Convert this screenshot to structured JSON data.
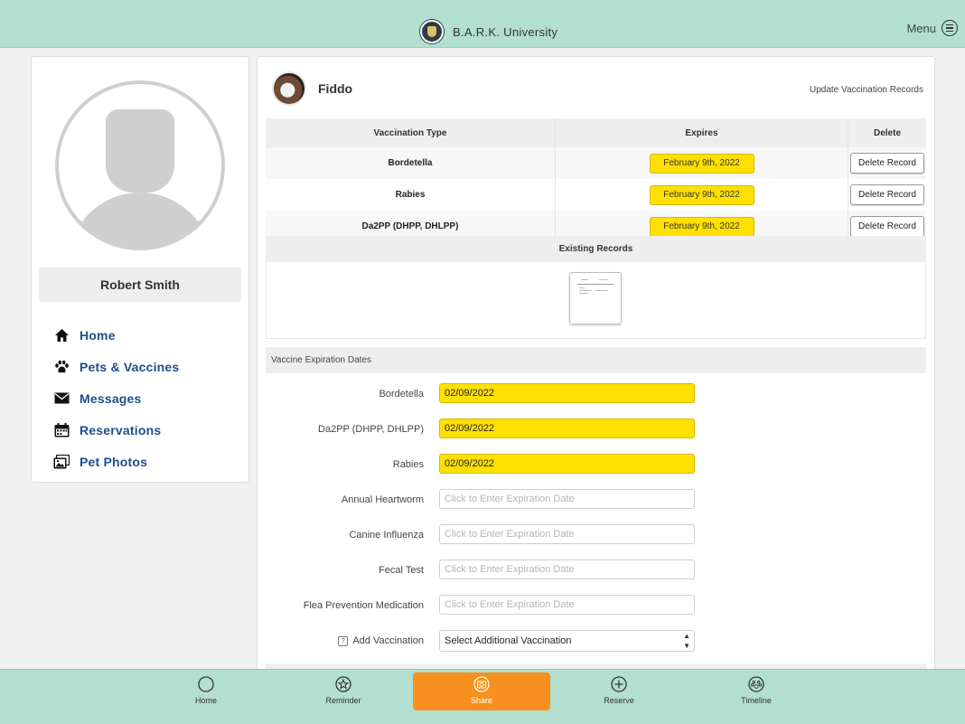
{
  "header": {
    "brand_name": "B.A.R.K. University",
    "menu_label": "Menu"
  },
  "profile": {
    "user_name": "Robert Smith"
  },
  "sidebar": {
    "items": [
      {
        "label": "Home",
        "icon": "house-icon"
      },
      {
        "label": "Pets & Vaccines",
        "icon": "paw-icon"
      },
      {
        "label": "Messages",
        "icon": "envelope-icon"
      },
      {
        "label": "Reservations",
        "icon": "calendar-icon"
      },
      {
        "label": "Pet Photos",
        "icon": "photos-icon"
      }
    ]
  },
  "pet": {
    "name": "Fiddo",
    "update_link": "Update Vaccination Records"
  },
  "vaccination_table": {
    "headers": {
      "type": "Vaccination Type",
      "expires": "Expires",
      "delete": "Delete"
    },
    "rows": [
      {
        "type": "Bordetella",
        "expires": "February 9th, 2022",
        "delete_label": "Delete Record"
      },
      {
        "type": "Rabies",
        "expires": "February 9th, 2022",
        "delete_label": "Delete Record"
      },
      {
        "type": "Da2PP (DHPP, DHLPP)",
        "expires": "February 9th, 2022",
        "delete_label": "Delete Record"
      }
    ]
  },
  "existing_records": {
    "title": "Existing Records"
  },
  "expiration_form": {
    "section_title": "Vaccine Expiration Dates",
    "placeholder": "Click to Enter Expiration Date",
    "fields": [
      {
        "label": "Bordetella",
        "value": "02/09/2022"
      },
      {
        "label": "Da2PP (DHPP, DHLPP)",
        "value": "02/09/2022"
      },
      {
        "label": "Rabies",
        "value": "02/09/2022"
      },
      {
        "label": "Annual Heartworm",
        "value": ""
      },
      {
        "label": "Canine Influenza",
        "value": ""
      },
      {
        "label": "Fecal Test",
        "value": ""
      },
      {
        "label": "Flea Prevention Medication",
        "value": ""
      }
    ],
    "add_vaccination": {
      "help_glyph": "?",
      "label": "Add Vaccination",
      "selected": "Select Additional Vaccination"
    }
  },
  "tabbar": {
    "tabs": [
      {
        "label": "Home",
        "icon": "circle-icon"
      },
      {
        "label": "Reminder",
        "icon": "star-icon"
      },
      {
        "label": "Share",
        "icon": "camera-icon",
        "active": true
      },
      {
        "label": "Reserve",
        "icon": "plus-circle-icon"
      },
      {
        "label": "Timeline",
        "icon": "paw-circle-icon"
      }
    ]
  },
  "colors": {
    "header_bg": "#b2dfcf",
    "nav_link": "#1f4e8c",
    "highlight_yellow": "#ffe000",
    "active_tab": "#f7901e"
  }
}
